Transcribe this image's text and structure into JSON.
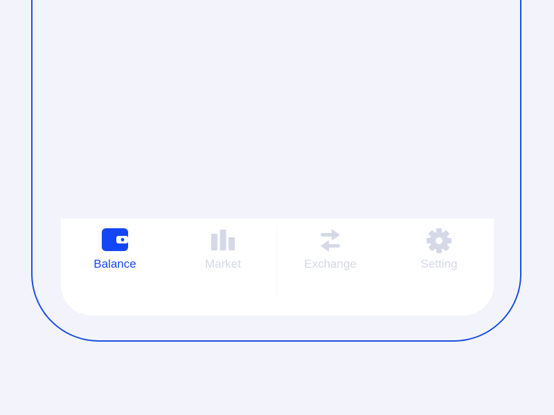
{
  "colors": {
    "background": "#f3f4fb",
    "frame": "#1a4fe0",
    "tab_bar": "#ffffff",
    "active": "#1346f5",
    "inactive": "#d5d8e7"
  },
  "tab_bar": {
    "active_tab": "Balance",
    "tabs": [
      {
        "label": "Balance",
        "icon": "wallet-icon",
        "active": true
      },
      {
        "label": "Market",
        "icon": "bar-chart-icon",
        "active": false
      },
      {
        "label": "Exchange",
        "icon": "swap-arrows-icon",
        "active": false
      },
      {
        "label": "Setting",
        "icon": "gear-icon",
        "active": false
      }
    ]
  }
}
